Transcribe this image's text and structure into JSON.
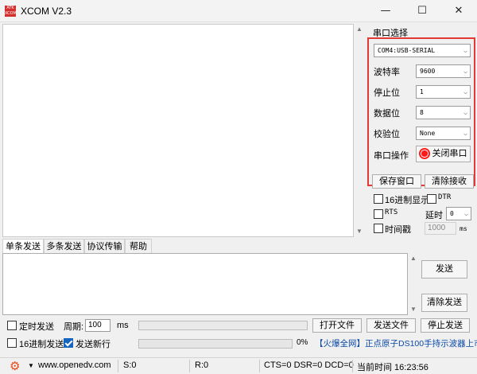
{
  "window": {
    "logo_text": "ATK XCOM",
    "title": "XCOM V2.3",
    "minimize": "—",
    "maximize": "☐",
    "close": "✕"
  },
  "serial": {
    "section_title": "串口选择",
    "port": "COM4:USB-SERIAL",
    "baud_label": "波特率",
    "baud": "9600",
    "stopbits_label": "停止位",
    "stopbits": "1",
    "databits_label": "数据位",
    "databits": "8",
    "parity_label": "校验位",
    "parity": "None",
    "operate_label": "串口操作",
    "operate_button": "关闭串口"
  },
  "options": {
    "save_window": "保存窗口",
    "clear_receive": "清除接收",
    "hex_display": "16进制显示",
    "dtr": "DTR",
    "rts": "RTS",
    "delay_label": "延时",
    "delay_value": "0",
    "timestamp": "时间戳",
    "timestamp_value": "1000",
    "timestamp_unit": "ms"
  },
  "tabs": [
    "单条发送",
    "多条发送",
    "协议传输",
    "帮助"
  ],
  "send": {
    "send_button": "发送",
    "clear_send": "清除发送",
    "timed_send": "定时发送",
    "period_label": "周期:",
    "period_value": "100",
    "period_unit": "ms",
    "open_file": "打开文件",
    "send_file": "发送文件",
    "stop_send": "停止发送",
    "hex_send": "16进制发送",
    "send_newline": "发送新行",
    "progress_text": "0%",
    "progress": 0,
    "promo": "【火爆全网】正点原子DS100手持示波器上市"
  },
  "status": {
    "website": "www.openedv.com",
    "sent": "S:0",
    "received": "R:0",
    "lines": "CTS=0 DSR=0 DCD=0",
    "time": "当前时间 16:23:56"
  },
  "colors": {
    "highlight_border": "#e53935",
    "link": "#0b4aa8",
    "checkbox_checked": "#1565c0"
  }
}
